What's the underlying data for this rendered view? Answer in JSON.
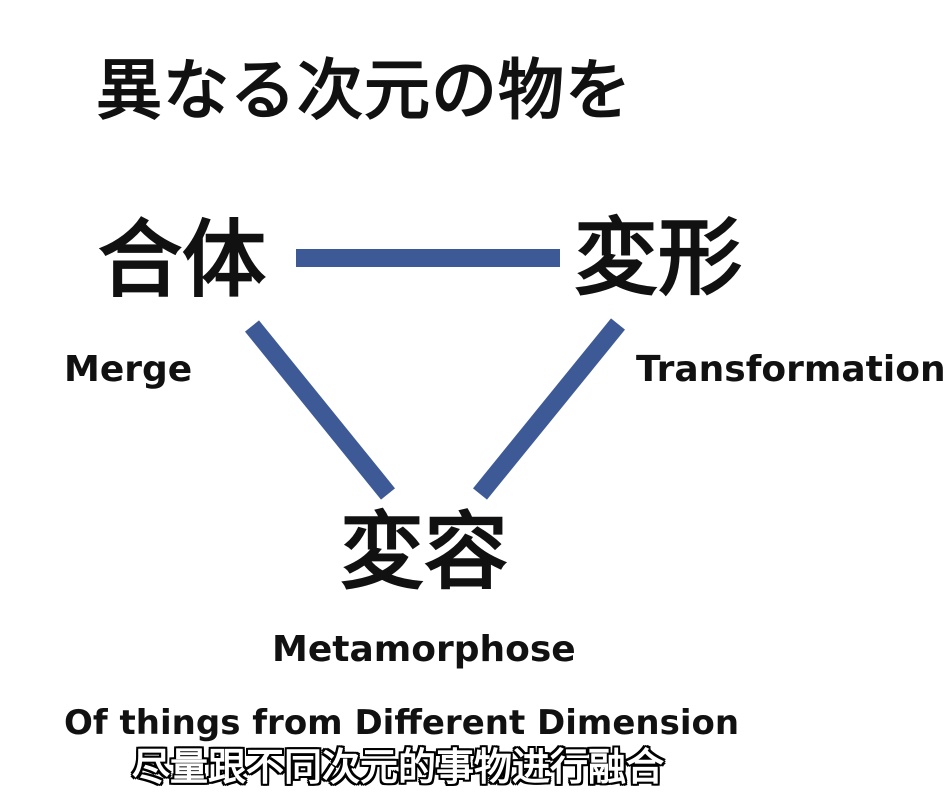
{
  "title": "異なる次元の物を",
  "nodes": {
    "merge": {
      "kanji": "合体",
      "english": "Merge"
    },
    "transformation": {
      "kanji": "変形",
      "english": "Transformation"
    },
    "metamorphose": {
      "kanji": "変容",
      "english": "Metamorphose"
    }
  },
  "footer": "Of things from Different Dimension",
  "subtitle": "尽量跟不同次元的事物进行融合",
  "colors": {
    "connector": "#3d5a96",
    "text": "#111111",
    "background": "#ffffff"
  }
}
